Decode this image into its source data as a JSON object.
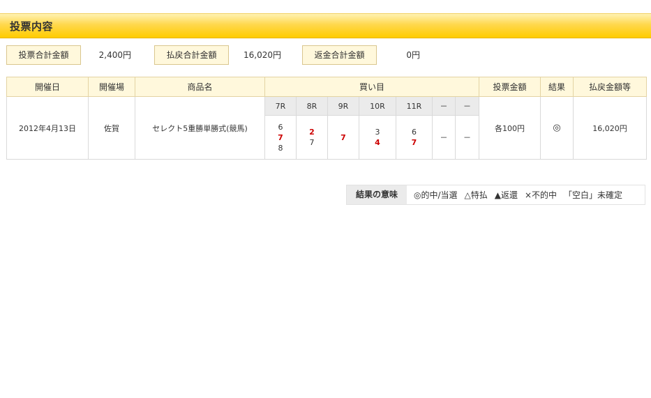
{
  "header": {
    "title": "投票内容"
  },
  "summary": {
    "bet_total_label": "投票合計金額",
    "bet_total_value": "2,400円",
    "payout_total_label": "払戻合計金額",
    "payout_total_value": "16,020円",
    "refund_total_label": "返金合計金額",
    "refund_total_value": "0円"
  },
  "table": {
    "headers": {
      "date": "開催日",
      "venue": "開催場",
      "product": "商品名",
      "picks": "買い目",
      "amount": "投票金額",
      "result": "結果",
      "payout": "払戻金額等"
    },
    "races": [
      "7R",
      "8R",
      "9R",
      "10R",
      "11R",
      "－",
      "－"
    ],
    "row": {
      "date": "2012年4月13日",
      "venue": "佐賀",
      "product": "セレクト5重勝単勝式(競馬)",
      "amount": "各100円",
      "result": "◎",
      "payout": "16,020円",
      "picks": [
        [
          {
            "n": "6",
            "hit": false
          },
          {
            "n": "7",
            "hit": true
          },
          {
            "n": "8",
            "hit": false
          }
        ],
        [
          {
            "n": "2",
            "hit": true
          },
          {
            "n": "7",
            "hit": false
          }
        ],
        [
          {
            "n": "7",
            "hit": true
          }
        ],
        [
          {
            "n": "3",
            "hit": false
          },
          {
            "n": "4",
            "hit": true
          }
        ],
        [
          {
            "n": "6",
            "hit": false
          },
          {
            "n": "7",
            "hit": true
          }
        ],
        [
          {
            "n": "－",
            "hit": false
          }
        ],
        [
          {
            "n": "－",
            "hit": false
          }
        ]
      ]
    }
  },
  "legend": {
    "title": "結果の意味",
    "items": [
      "◎的中/当選",
      "△特払",
      "▲返還",
      "×不的中",
      "「空白」未確定"
    ]
  },
  "colors": {
    "header_gradient_bottom": "#ffcc00",
    "label_bg": "#fff8dc",
    "hit_red": "#cc0000"
  }
}
